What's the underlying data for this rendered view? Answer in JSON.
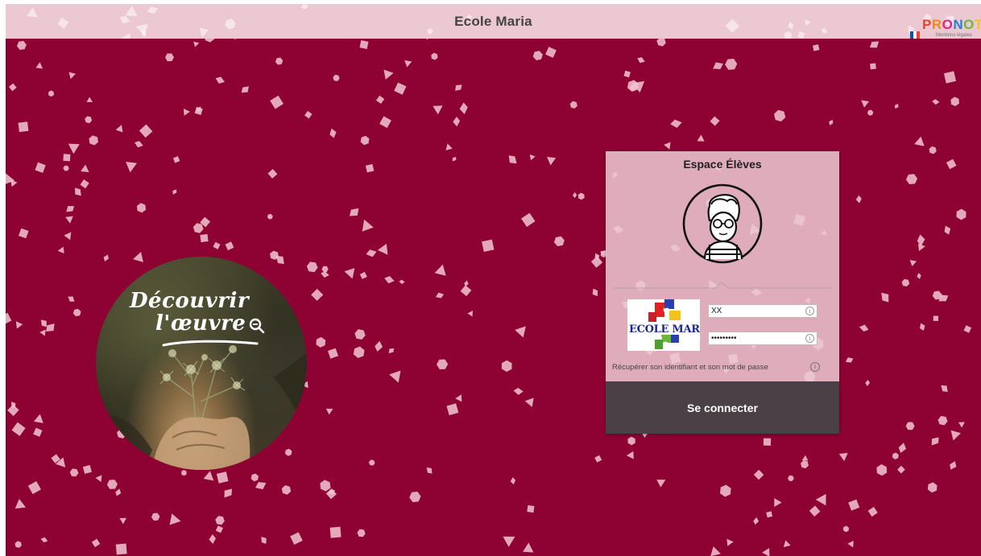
{
  "header": {
    "title": "Ecole Maria",
    "logo_text": "PRONOTE",
    "legal_link": "Mentions légales",
    "flag_colors": [
      "#0055a4",
      "#ffffff",
      "#ef4135"
    ]
  },
  "colors": {
    "background": "#8d0232",
    "header_bg": "#ecc8d3",
    "card_bg": "#ecc8d3",
    "button_bg": "#4b4045"
  },
  "discover": {
    "line1": "Découvrir",
    "line2": "l'œuvre"
  },
  "login": {
    "title": "Espace Élèves",
    "school_logo_text": "ECOLE MARIA",
    "username_value": "XX",
    "password_value": "•••••••••",
    "recover_link": "Récupérer son identifiant et son mot de passe",
    "info_glyph": "i",
    "submit_label": "Se connecter"
  }
}
